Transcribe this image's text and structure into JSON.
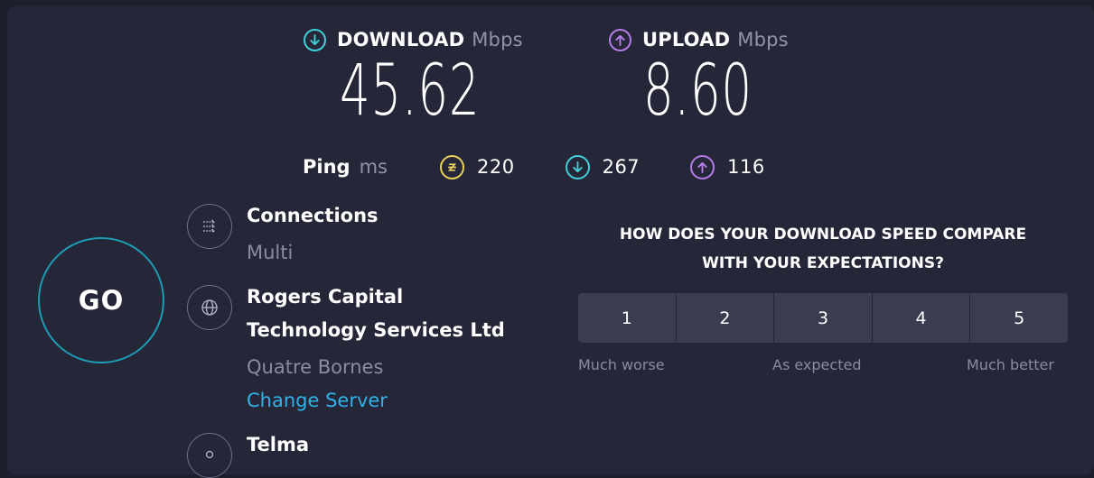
{
  "download": {
    "label": "DOWNLOAD",
    "unit": "Mbps",
    "value": "45.62",
    "icon": "download-arrow-icon",
    "color": "#3fd0d8"
  },
  "upload": {
    "label": "UPLOAD",
    "unit": "Mbps",
    "value": "8.60",
    "icon": "upload-arrow-icon",
    "color": "#b47ce8"
  },
  "ping": {
    "label": "Ping",
    "unit": "ms",
    "idle": {
      "value": "220",
      "icon": "idle-ping-icon",
      "color": "#e8d25a"
    },
    "download": {
      "value": "267",
      "icon": "download-ping-icon",
      "color": "#3fd0d8"
    },
    "upload": {
      "value": "116",
      "icon": "upload-ping-icon",
      "color": "#b47ce8"
    }
  },
  "go_label": "GO",
  "connections": {
    "title": "Connections",
    "value": "Multi",
    "icon": "connections-icon"
  },
  "server": {
    "title_line1": "Rogers Capital",
    "title_line2": "Technology Services Ltd",
    "location": "Quatre Bornes",
    "change_label": "Change Server",
    "icon": "globe-icon"
  },
  "isp": {
    "title": "Telma",
    "icon": "user-icon"
  },
  "survey": {
    "question_line1": "HOW DOES YOUR DOWNLOAD SPEED COMPARE",
    "question_line2": "WITH YOUR EXPECTATIONS?",
    "options": [
      "1",
      "2",
      "3",
      "4",
      "5"
    ],
    "low_label": "Much worse",
    "mid_label": "As expected",
    "high_label": "Much better"
  },
  "colors": {
    "background": "#1e1f2e",
    "panel": "#252637",
    "accent": "#1d9bb4",
    "link": "#2fb3e8"
  }
}
